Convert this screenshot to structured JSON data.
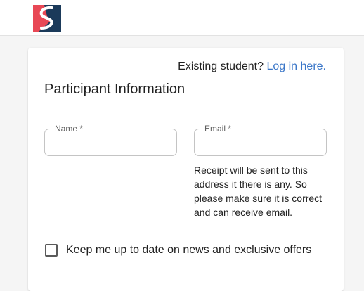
{
  "header": {
    "logo_icon": "s-brand-logo-icon",
    "brand_colors": {
      "red": "#e84855",
      "navy": "#1b3a5a"
    }
  },
  "login_prompt": {
    "text": "Existing student?",
    "link_label": "Log in here."
  },
  "form": {
    "title": "Participant Information",
    "name_field": {
      "label": "Name *",
      "value": ""
    },
    "email_field": {
      "label": "Email *",
      "value": ""
    },
    "email_helper": "Receipt will be sent to this address it there is any. So please make sure it is correct and can receive email.",
    "newsletter": {
      "label": "Keep me up to date on news and exclusive offers",
      "checked": false
    }
  },
  "colors": {
    "link": "#3a76c8",
    "field_border": "#c4c4c4",
    "page_bg": "#f5f5f5"
  }
}
